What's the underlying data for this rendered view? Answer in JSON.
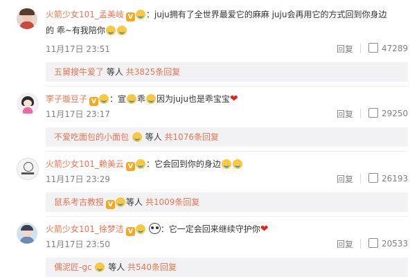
{
  "comments": [
    {
      "username": "火箭少女101_孟美岐",
      "text": "：juju拥有了全世界最爱它的麻麻 juju会再用它的方式回到你身边",
      "text2": "的 乖~有我陪你",
      "time": "11月17日 23:51",
      "reply_label": "回复",
      "likes": "47289",
      "sub_user": "五舅搜牛爱了",
      "sub_etc": "等人",
      "sub_count": "共3825条回复"
    },
    {
      "username": "李子璇豆子",
      "text": "：宣",
      "text_mid": "乖",
      "text_end": "因为juju也是乖宝宝",
      "time": "11月17日 23:17",
      "reply_label": "回复",
      "likes": "29250",
      "sub_user": "不爱吃面包的小面包",
      "sub_etc": "等人",
      "sub_count": "共1076条回复"
    },
    {
      "username": "火箭少女101_赖美云",
      "text": "：它会回到你的身边",
      "time": "11月17日 23:29",
      "reply_label": "回复",
      "likes": "26193",
      "sub_user": "鼠系考古教授",
      "sub_etc": "等人",
      "sub_count": "共1009条回复"
    },
    {
      "username": "火箭少女101_徐梦洁",
      "text": "：它一定会回来继续守护你",
      "time": "11月17日 23:50",
      "reply_label": "回复",
      "likes": "20533",
      "sub_user": "偶泥匠-gc",
      "sub_etc": "等人",
      "sub_count": "共540条回复"
    }
  ],
  "badge_char": "V",
  "icons": [
    "thumb-up-icon",
    "smile-emoji-icon",
    "heart-icon",
    "panda-icon"
  ],
  "colors": {
    "username": "#eb7350",
    "meta": "#808080",
    "subbox_bg": "#f2f2f5"
  }
}
